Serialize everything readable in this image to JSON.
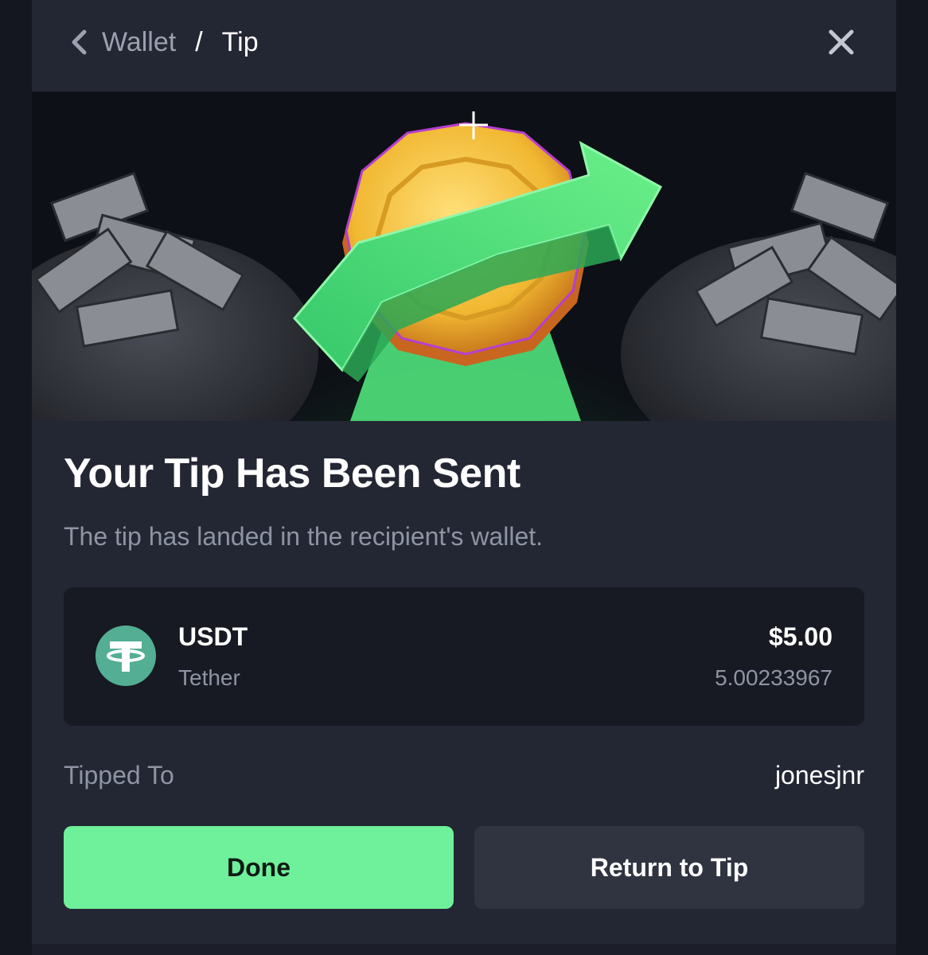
{
  "header": {
    "back_icon": "chevron-left-icon",
    "breadcrumb_parent": "Wallet",
    "breadcrumb_separator": "/",
    "breadcrumb_current": "Tip",
    "close_icon": "close-icon"
  },
  "hero": {
    "image": "coin-with-green-arrow-and-money-bags"
  },
  "main": {
    "title": "Your Tip Has Been Sent",
    "subtitle": "The tip has landed in the recipient's wallet."
  },
  "asset": {
    "icon": "tether-icon",
    "symbol": "USDT",
    "name": "Tether",
    "usd_value": "$5.00",
    "amount": "5.00233967"
  },
  "tipped": {
    "label": "Tipped To",
    "recipient": "jonesjnr"
  },
  "actions": {
    "done_label": "Done",
    "return_label": "Return to Tip"
  },
  "colors": {
    "background": "#232733",
    "card": "#171a22",
    "accent_green": "#6ff09a",
    "tether_green": "#53ae94",
    "muted_text": "#8e94a4"
  }
}
